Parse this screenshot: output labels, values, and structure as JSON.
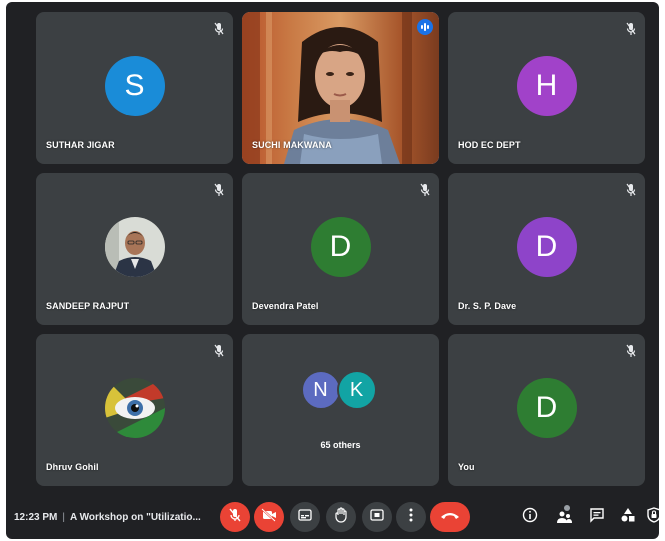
{
  "participants": [
    {
      "name": "SUTHAR JIGAR",
      "initial": "S",
      "color": "#1a8cd8"
    },
    {
      "name": "SUCHI MAKWANA"
    },
    {
      "name": "HOD EC DEPT",
      "initial": "H",
      "color": "#a142c9"
    },
    {
      "name": "SANDEEP RAJPUT"
    },
    {
      "name": "Devendra Patel",
      "initial": "D",
      "color": "#2e7d32"
    },
    {
      "name": "Dr. S. P. Dave",
      "initial": "D",
      "color": "#8e44c9"
    },
    {
      "name": "Dhruv Gohil"
    },
    {
      "name": "You",
      "initial": "D",
      "color": "#2e7d32"
    }
  ],
  "others": {
    "initials": [
      "N",
      "K"
    ],
    "colors": [
      "#5c6bc0",
      "#12a4a4"
    ],
    "count_label": "65 others"
  },
  "bottom_bar": {
    "time": "12:23 PM",
    "meeting_title": "A Workshop on \"Utilizatio..."
  },
  "colors": {
    "background": "#202124",
    "tile": "#3c4043",
    "danger": "#ea4335",
    "speaking_outline": "#8ab4f8"
  },
  "icons": {
    "mic_off": "mic-off-icon",
    "camera_off": "camera-off-icon",
    "captions": "captions-icon",
    "raise_hand": "hand-icon",
    "present": "present-icon",
    "more": "more-vert-icon",
    "end_call": "end-call-icon",
    "info": "info-icon",
    "people": "people-icon",
    "chat": "chat-icon",
    "activities": "activities-icon",
    "host_controls": "lock-icon"
  }
}
